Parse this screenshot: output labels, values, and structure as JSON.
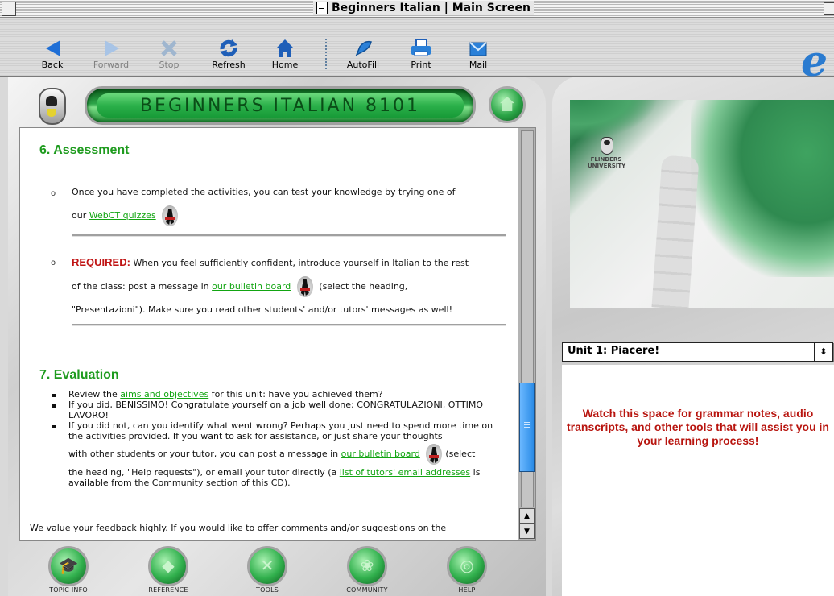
{
  "window": {
    "title": "Beginners Italian | Main Screen"
  },
  "toolbar": {
    "back": "Back",
    "forward": "Forward",
    "stop": "Stop",
    "refresh": "Refresh",
    "home": "Home",
    "autofill": "AutoFill",
    "print": "Print",
    "mail": "Mail"
  },
  "header": {
    "banner": "BEGINNERS ITALIAN 8101"
  },
  "assessment": {
    "heading": "6. Assessment",
    "item1_text_a": "Once you have completed the activities, you can test your knowledge by trying one of",
    "item1_text_b": "our",
    "item1_link": "WebCT quizzes",
    "item2_required": "REQUIRED:",
    "item2_text_a": " When you feel sufficiently confident, introduce yourself in Italian to the rest",
    "item2_text_b": "of the class: post a message in",
    "item2_link": "our bulletin board",
    "item2_text_c": "(select the heading,",
    "item2_text_d": "\"Presentazioni\"). Make sure you read other students' and/or tutors' messages as well!"
  },
  "evaluation": {
    "heading": "7. Evaluation",
    "b1_a": "Review the ",
    "b1_link": "aims and objectives",
    "b1_b": " for this unit: have you achieved them?",
    "b2": "If you did, BENISSIMO! Congratulate yourself on a job well done: CONGRATULAZIONI, OTTIMO LAVORO!",
    "b3_a": "If you did not, can you identify what went wrong? Perhaps you just need to spend more time on the activities provided. If you want to ask for assistance, or just share your thoughts",
    "b3_b": "with other students or your tutor, you can post a message in ",
    "b3_link": "our bulletin board",
    "b3_c": "(select",
    "b3_d": "the heading, \"Help requests\"), or email your tutor directly (a ",
    "b3_link2": "list of tutors' email addresses",
    "b3_e": " is available from the Community section of this CD).",
    "feedback": "We value your feedback highly. If you would like to offer comments and/or suggestions on the"
  },
  "nav": {
    "topic_info": "TOPIC INFO",
    "reference": "REFERENCE",
    "tools": "TOOLS",
    "community": "COMMUNITY",
    "help": "HELP"
  },
  "sidebar": {
    "university": "FLINDERS UNIVERSITY",
    "unit_select": "Unit 1: Piacere!",
    "notes": "Watch this space for grammar notes, audio transcripts, and other tools that will assist you in your learning process!"
  },
  "colors": {
    "accent_green": "#1e9b1e",
    "required_red": "#c01515",
    "notes_red": "#b8150f",
    "scroll_blue": "#2a8be6"
  }
}
